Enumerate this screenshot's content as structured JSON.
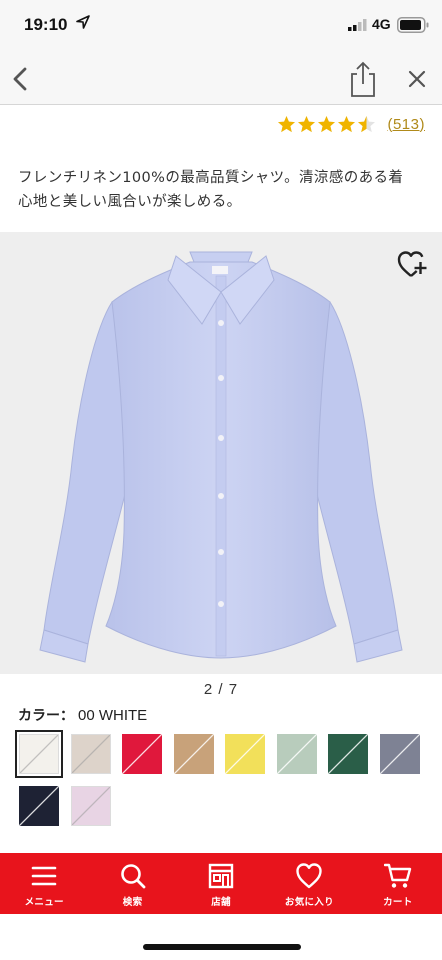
{
  "status_bar": {
    "time": "19:10",
    "network": "4G",
    "icons": [
      "location-arrow-icon",
      "signal-bars-icon",
      "battery-icon"
    ]
  },
  "nav": {
    "icons": [
      "back-chevron-icon",
      "share-icon",
      "close-icon"
    ]
  },
  "rating": {
    "stars": 4.5,
    "max_stars": 5,
    "review_count": "(513)",
    "star_color": "#f0b400"
  },
  "description": {
    "line1": "フレンチリネン100%の最高品質シャツ。清涼感のある着",
    "line2": "心地と美しい風合いが楽しめる。"
  },
  "gallery": {
    "pager": "2 / 7",
    "product_color": "#c8d0f0",
    "favorite_icon": "heart-plus-icon"
  },
  "color_picker": {
    "label": "カラー：",
    "selected_value": "00 WHITE",
    "swatches": [
      {
        "name": "white",
        "color": "#f3f1ec",
        "selected": true
      },
      {
        "name": "beige",
        "color": "#ddd3ca",
        "selected": false
      },
      {
        "name": "red",
        "color": "#e0183c",
        "selected": false
      },
      {
        "name": "tan",
        "color": "#c8a27a",
        "selected": false
      },
      {
        "name": "yellow",
        "color": "#f2e05a",
        "selected": false
      },
      {
        "name": "sage",
        "color": "#b8ccbc",
        "selected": false
      },
      {
        "name": "green",
        "color": "#2a5e48",
        "selected": false
      },
      {
        "name": "gray-chambray",
        "color": "#7e8294",
        "selected": false
      },
      {
        "name": "navy",
        "color": "#1e2234",
        "selected": false
      },
      {
        "name": "lavender",
        "color": "#e8d4e4",
        "selected": false
      }
    ]
  },
  "tabbar": {
    "background": "#e8141c",
    "items": [
      {
        "label": "メニュー",
        "icon": "menu-icon"
      },
      {
        "label": "検索",
        "icon": "search-icon"
      },
      {
        "label": "店舗",
        "icon": "store-icon"
      },
      {
        "label": "お気に入り",
        "icon": "heart-icon"
      },
      {
        "label": "カート",
        "icon": "cart-icon"
      }
    ]
  }
}
